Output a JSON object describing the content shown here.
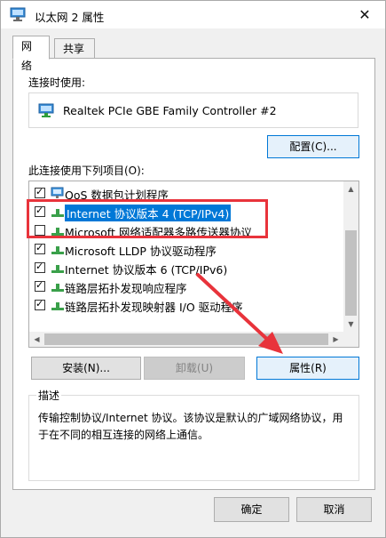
{
  "window": {
    "title": "以太网 2 属性",
    "close_glyph": "✕"
  },
  "tabs": [
    {
      "label": "网络",
      "active": true
    },
    {
      "label": "共享",
      "active": false
    }
  ],
  "connect": {
    "label": "连接时使用:",
    "adapter_name": "Realtek PCIe GBE Family Controller #2",
    "config_button": "配置(C)..."
  },
  "items": {
    "label": "此连接使用下列项目(O):",
    "rows": [
      {
        "label": "QoS 数据包计划程序",
        "checked": true,
        "selected": false,
        "icon": "qos-scheduler-icon"
      },
      {
        "label": "Internet 协议版本 4 (TCP/IPv4)",
        "checked": true,
        "selected": true,
        "icon": "network-protocol-icon"
      },
      {
        "label": "Microsoft 网络适配器多路传送器协议",
        "checked": false,
        "selected": false,
        "icon": "network-protocol-icon"
      },
      {
        "label": "Microsoft LLDP 协议驱动程序",
        "checked": true,
        "selected": false,
        "icon": "network-protocol-icon"
      },
      {
        "label": "Internet 协议版本 6 (TCP/IPv6)",
        "checked": true,
        "selected": false,
        "icon": "network-protocol-icon"
      },
      {
        "label": "链路层拓扑发现响应程序",
        "checked": true,
        "selected": false,
        "icon": "network-protocol-icon"
      },
      {
        "label": "链路层拓扑发现映射器 I/O 驱动程序",
        "checked": true,
        "selected": false,
        "icon": "network-protocol-icon"
      }
    ]
  },
  "actions": {
    "install": "安装(N)...",
    "uninstall": "卸载(U)",
    "properties": "属性(R)"
  },
  "description": {
    "legend": "描述",
    "text": "传输控制协议/Internet 协议。该协议是默认的广域网络协议，用于在不同的相互连接的网络上通信。"
  },
  "footer": {
    "ok": "确定",
    "cancel": "取消"
  },
  "colors": {
    "accent": "#0078d7",
    "annotation": "#e8333b"
  }
}
